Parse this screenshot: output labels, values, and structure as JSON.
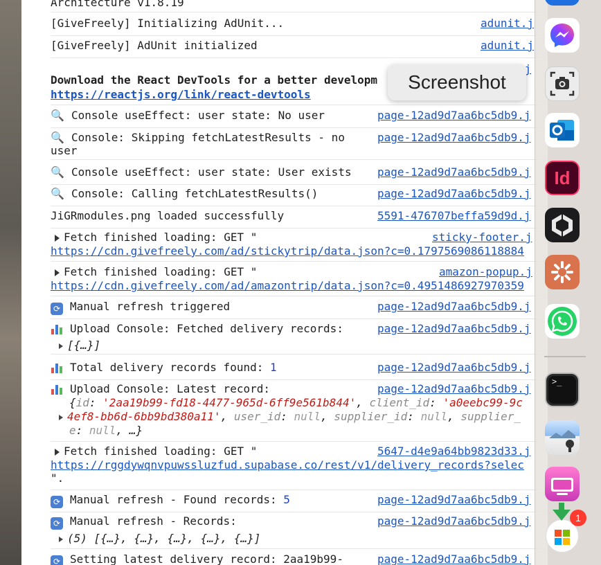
{
  "console": {
    "rows": [
      {
        "msg": "Architecture v1.8.19",
        "src": ""
      },
      {
        "msg": "[GiveFreely] Initializing AdUnit...",
        "src": "adunit.j"
      },
      {
        "msg": "[GiveFreely] AdUnit initialized",
        "src": "adunit.j"
      },
      {
        "msg_bold": "Download the React DevTools for a better developm",
        "url": "https://reactjs.org/link/react-devtools",
        "src": "vendors-bundle.j"
      },
      {
        "icon": "magnifier",
        "msg": "Console useEffect: user state: No user",
        "src": "page-12ad9d7aa6bc5db9.j"
      },
      {
        "icon": "magnifier",
        "msg": "Console: Skipping fetchLatestResults - no",
        "msg2": "user",
        "src": "page-12ad9d7aa6bc5db9.j"
      },
      {
        "icon": "magnifier",
        "msg": "Console useEffect: user state: User exists",
        "src": "page-12ad9d7aa6bc5db9.j"
      },
      {
        "icon": "magnifier",
        "msg": "Console: Calling fetchLatestResults()",
        "src": "page-12ad9d7aa6bc5db9.j"
      },
      {
        "msg": "JiGRmodules.png loaded successfully",
        "src": "5591-476707beffa59d9d.j"
      },
      {
        "msg": "Fetch finished loading: GET \"",
        "url": "https://cdn.givefreely.com/ad/stickytrip/data.json?c=0.1797569086118884",
        "src": "sticky-footer.j"
      },
      {
        "msg": "Fetch finished loading: GET \"",
        "url": "https://cdn.givefreely.com/ad/amazontrip/data.json?c=0.4951486927970359",
        "src": "amazon-popup.j"
      },
      {
        "icon": "refresh",
        "msg": "Manual refresh triggered",
        "src": "page-12ad9d7aa6bc5db9.j"
      },
      {
        "icon": "chart",
        "msg": "Upload Console: Fetched delivery records:",
        "msg2": "[{…}]",
        "src": "page-12ad9d7aa6bc5db9.j"
      },
      {
        "icon": "chart",
        "msg": "Total delivery records found: ",
        "num": "1",
        "src": "page-12ad9d7aa6bc5db9.j"
      },
      {
        "icon": "chart",
        "msg": "Upload Console: Latest record:",
        "obj_l1_a": "{",
        "obj_k_id": "id",
        "obj_v_id": "'2aa19b99-fd18-4477-965d-6ff9e561b844'",
        "obj_k_client": "client_id",
        "obj_v_client": "'a0eebc99-9c",
        "obj_l2_v": "4ef8-bb6d-6bb9bd380a11'",
        "obj_k_user": "user_id",
        "obj_k_supplier": "supplier_id",
        "obj_k_supplier2": "supplier_",
        "obj_l3_k": "e",
        "null": "null",
        "ellipsis": "…}",
        "src": "page-12ad9d7aa6bc5db9.j"
      },
      {
        "msg": "Fetch finished loading: GET \"",
        "url": "https://rggdywqnvpuwssluzfud.supabase.co/rest/v1/delivery_records?selec",
        "msg3": "\".",
        "src": "5647-d4e9a64bb9823d33.j"
      },
      {
        "icon": "refresh",
        "msg": "Manual refresh - Found records: ",
        "num": "5",
        "src": "page-12ad9d7aa6bc5db9.j"
      },
      {
        "icon": "refresh",
        "msg": "Manual refresh - Records:",
        "msg2": "(5) [{…}, {…}, {…}, {…}, {…}]",
        "src": "page-12ad9d7aa6bc5db9.j"
      },
      {
        "icon": "refresh",
        "msg": "Setting latest delivery record: 2aa19b99-",
        "src": "page-12ad9d7aa6bc5db9.j"
      }
    ]
  },
  "tooltip": {
    "label": "Screenshot"
  },
  "dock": {
    "apps": [
      "messenger-icon",
      "screenshot-icon",
      "outlook-icon",
      "indesign-icon",
      "perplexity-icon",
      "claude-icon",
      "whatsapp-icon",
      "terminal-icon",
      "preview-icon",
      "cleanmymac-icon",
      "app-store-installer-icon"
    ],
    "indesign_label": "Id",
    "terminal_label": ">_",
    "badge_count": "1"
  },
  "colors": {
    "link": "#1a55c4",
    "string": "#c41a16",
    "number": "#1a3fd0"
  }
}
